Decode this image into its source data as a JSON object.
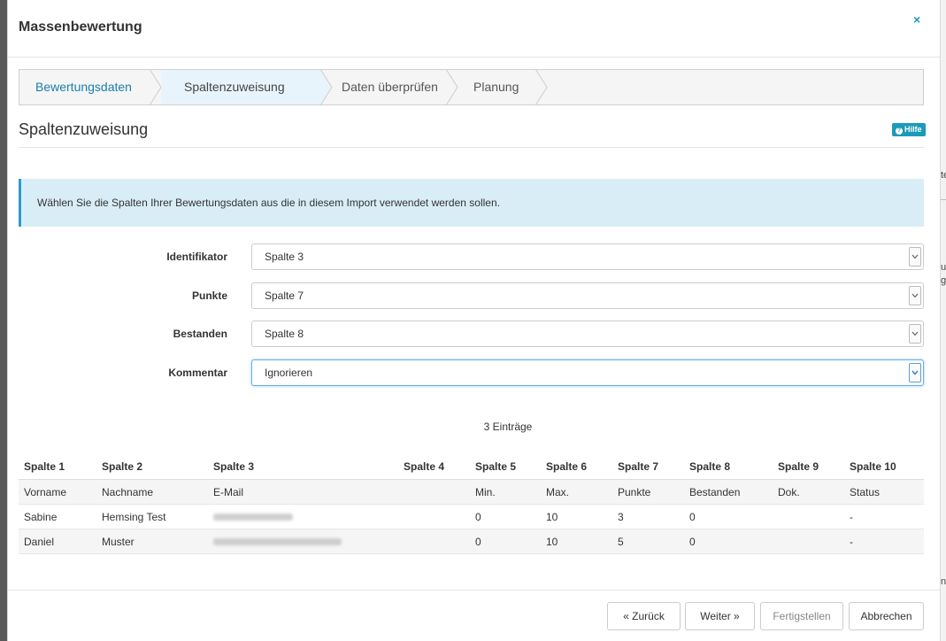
{
  "modal": {
    "title": "Massenbewertung",
    "close_icon": "×"
  },
  "wizard": {
    "steps": [
      {
        "label": "Bewertungsdaten"
      },
      {
        "label": "Spaltenzuweisung"
      },
      {
        "label": "Daten überprüfen"
      },
      {
        "label": "Planung"
      }
    ]
  },
  "section": {
    "title": "Spaltenzuweisung",
    "help_label": "Hilfe",
    "help_icon": "?"
  },
  "info": {
    "text": "Wählen Sie die Spalten Ihrer Bewertungsdaten aus die in diesem Import verwendet werden sollen."
  },
  "form": {
    "fields": [
      {
        "label": "Identifikator",
        "value": "Spalte 3"
      },
      {
        "label": "Punkte",
        "value": "Spalte 7"
      },
      {
        "label": "Bestanden",
        "value": "Spalte 8"
      },
      {
        "label": "Kommentar",
        "value": "Ignorieren"
      }
    ]
  },
  "table": {
    "count_label": "3 Einträge",
    "headers": [
      "Spalte 1",
      "Spalte 2",
      "Spalte 3",
      "Spalte 4",
      "Spalte 5",
      "Spalte 6",
      "Spalte 7",
      "Spalte 8",
      "Spalte 9",
      "Spalte 10"
    ],
    "rows": [
      [
        "Vorname",
        "Nachname",
        "E-Mail",
        "",
        "Min.",
        "Max.",
        "Punkte",
        "Bestanden",
        "Dok.",
        "Status"
      ],
      [
        "Sabine",
        "Hemsing Test",
        "",
        "",
        "0",
        "10",
        "3",
        "0",
        "",
        "-"
      ],
      [
        "Daniel",
        "Muster",
        "",
        "",
        "0",
        "10",
        "5",
        "0",
        "",
        "-"
      ]
    ]
  },
  "footer": {
    "back_label": "« Zurück",
    "next_label": "Weiter »",
    "finish_label": "Fertigstellen",
    "cancel_label": "Abbrechen"
  },
  "colors": {
    "accent": "#1b9bb8",
    "info_bg": "#d9edf7",
    "active_step_bg": "#e8f4fb"
  }
}
